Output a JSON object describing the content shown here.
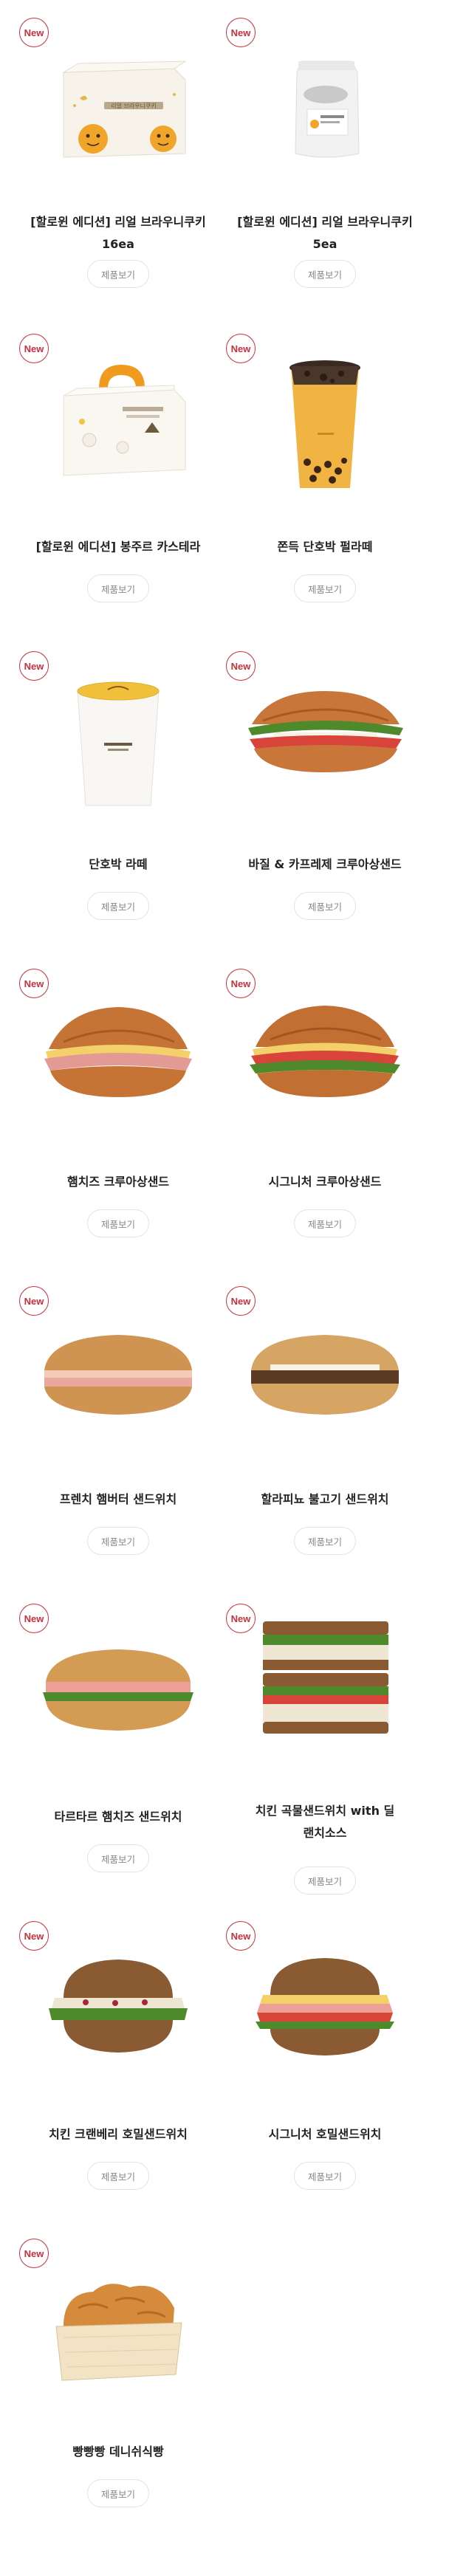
{
  "badge_label": "New",
  "button_label": "제품보기",
  "accent_color": "#c8303d",
  "products": [
    {
      "name": "[할로윈 에디션] 리얼 브라우니쿠키\n16ea",
      "icon": "halloween-cookie-box-icon",
      "box_title": "리얼 브라우니쿠키"
    },
    {
      "name": "[할로윈 에디션] 리얼 브라우니쿠키\n5ea",
      "icon": "cookie-bag-icon"
    },
    {
      "name": "[할로윈 에디션] 봉주르 카스테라",
      "icon": "castella-box-icon"
    },
    {
      "name": "쫀득 단호박 펄라떼",
      "icon": "pumpkin-pearl-latte-icon"
    },
    {
      "name": "단호박 라떼",
      "icon": "pumpkin-latte-cup-icon"
    },
    {
      "name": "바질 & 카프레제 크루아상샌드",
      "icon": "croissant-sandwich-icon"
    },
    {
      "name": "햄치즈 크루아상샌드",
      "icon": "croissant-sandwich-icon"
    },
    {
      "name": "시그니처 크루아상샌드",
      "icon": "croissant-sandwich-icon"
    },
    {
      "name": "프렌치 햄버터 샌드위치",
      "icon": "ciabatta-sandwich-icon"
    },
    {
      "name": "할라피뇨 불고기 샌드위치",
      "icon": "ciabatta-sandwich-icon"
    },
    {
      "name": "타르타르 햄치즈 샌드위치",
      "icon": "ciabatta-sandwich-icon"
    },
    {
      "name": "치킨 곡물샌드위치 with 딜\n랜치소스",
      "icon": "grain-sandwich-stack-icon"
    },
    {
      "name": "치킨 크랜베리 호밀샌드위치",
      "icon": "rye-sandwich-icon"
    },
    {
      "name": "시그니처 호밀샌드위치",
      "icon": "rye-sandwich-icon"
    },
    {
      "name": "빵빵빵 데니쉬식빵",
      "icon": "danish-loaf-icon"
    }
  ]
}
